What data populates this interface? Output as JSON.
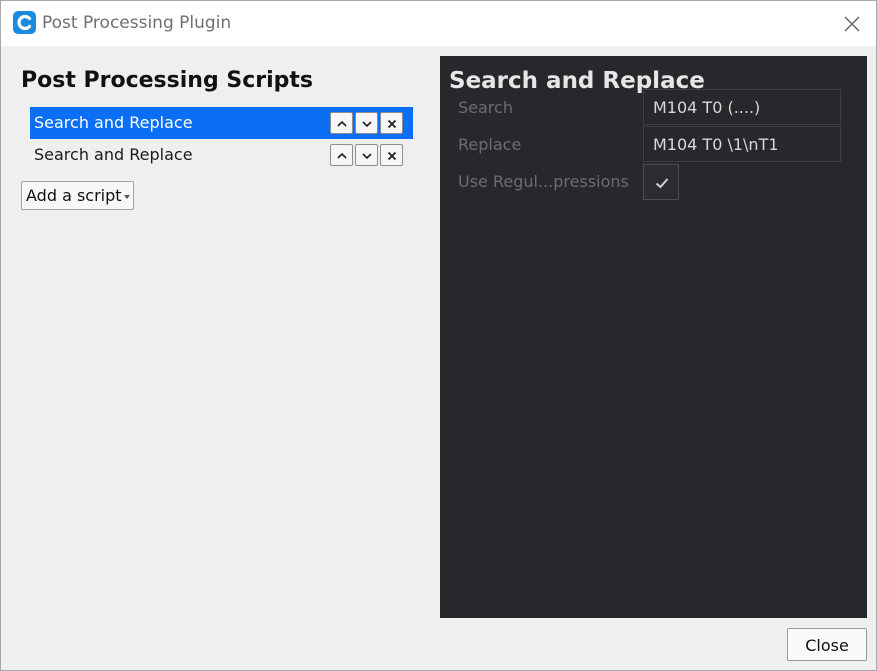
{
  "window": {
    "title": "Post Processing Plugin"
  },
  "left": {
    "heading": "Post Processing Scripts",
    "scripts": [
      {
        "label": "Search and Replace",
        "selected": true
      },
      {
        "label": "Search and Replace",
        "selected": false
      }
    ],
    "add_script_label": "Add a script"
  },
  "settings": {
    "heading": "Search and Replace",
    "fields": [
      {
        "label": "Search",
        "value": "M104 T0 (....)"
      },
      {
        "label": "Replace",
        "value": "M104 T0 \\1\\nT1"
      }
    ],
    "regex_label": "Use Regul...pressions",
    "regex_checked": true
  },
  "footer": {
    "close_label": "Close"
  },
  "colors": {
    "accent": "#0a6ff5",
    "app_icon": "#1b8be0",
    "panel_dark": "#26282b"
  },
  "icons": [
    "cura-app-icon",
    "close-icon",
    "chevron-up-icon",
    "chevron-down-icon",
    "remove-icon",
    "checkmark-icon",
    "dropdown-caret-icon"
  ]
}
